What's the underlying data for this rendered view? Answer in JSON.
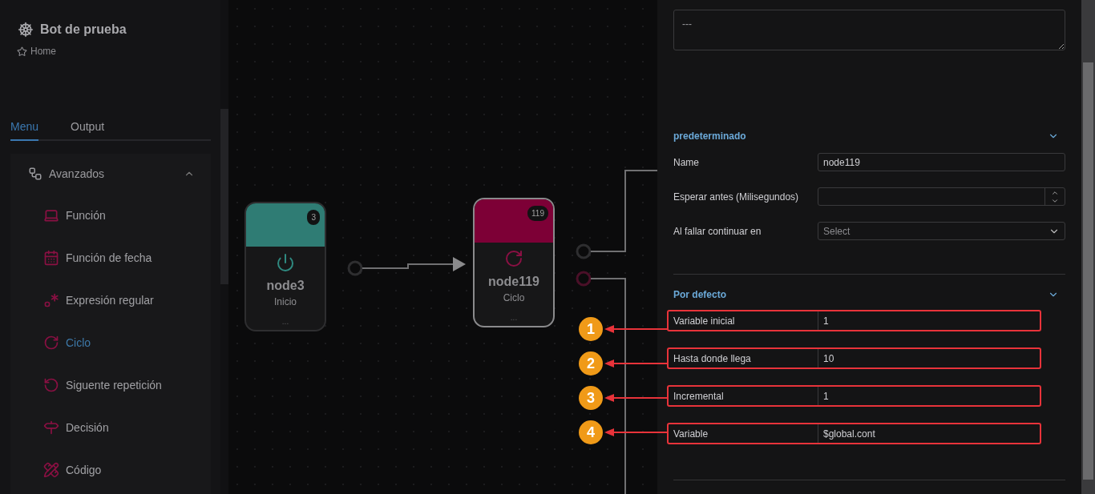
{
  "sidebar": {
    "title": "Bot de prueba",
    "breadcrumb": "Home",
    "tabs": [
      {
        "label": "Menu",
        "selected": true
      },
      {
        "label": "Output",
        "selected": false
      }
    ],
    "group": {
      "label": "Avanzados",
      "expanded": true,
      "items": [
        {
          "label": "Función",
          "kind": "function",
          "selected": false
        },
        {
          "label": "Función de fecha",
          "kind": "date",
          "selected": false
        },
        {
          "label": "Expresión regular",
          "kind": "regex",
          "selected": false
        },
        {
          "label": "Ciclo",
          "kind": "loop",
          "selected": true
        },
        {
          "label": "Siguente repetición",
          "kind": "repeat",
          "selected": false
        },
        {
          "label": "Decisión",
          "kind": "decision",
          "selected": false
        },
        {
          "label": "Código",
          "kind": "code",
          "selected": false
        }
      ]
    }
  },
  "canvas": {
    "nodes": [
      {
        "kind": "start",
        "badge": "3",
        "name": "node3",
        "type": "Inicio",
        "footer": "...",
        "selected": false
      },
      {
        "kind": "loop",
        "badge": "119",
        "name": "node119",
        "type": "Ciclo",
        "footer": "...",
        "selected": true
      }
    ]
  },
  "panel": {
    "description": "---",
    "sections": [
      {
        "title": "predeterminado",
        "expanded": true,
        "fields": [
          {
            "label": "Name",
            "kind": "text",
            "value": "node119"
          },
          {
            "label": "Esperar antes (Milisegundos)",
            "kind": "number"
          },
          {
            "label": "Al fallar continuar en",
            "kind": "select",
            "placeholder": "Select"
          }
        ]
      },
      {
        "title": "Por defecto",
        "expanded": true,
        "fields": [
          {
            "label": "Variable inicial",
            "kind": "inline",
            "value": "1",
            "callout": "1"
          },
          {
            "label": "Hasta donde llega",
            "kind": "inline",
            "value": "10",
            "callout": "2"
          },
          {
            "label": "Incremental",
            "kind": "inline",
            "value": "1",
            "callout": "3"
          },
          {
            "label": "Variable",
            "kind": "inline",
            "value": "$global.cont",
            "callout": "4"
          }
        ]
      }
    ]
  }
}
